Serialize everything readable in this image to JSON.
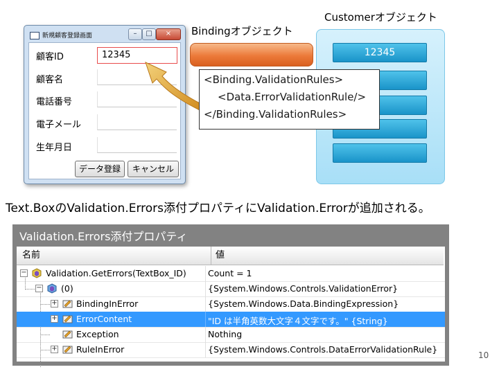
{
  "window": {
    "title": "新規顧客登録画面",
    "min_label": "–",
    "max_label": "□",
    "close_label": "×",
    "fields": [
      {
        "label": "顧客ID",
        "value": "12345"
      },
      {
        "label": "顧客名",
        "value": ""
      },
      {
        "label": "電話番号",
        "value": ""
      },
      {
        "label": "電子メール",
        "value": ""
      },
      {
        "label": "生年月日",
        "value": ""
      }
    ],
    "save_button": "データ登録",
    "cancel_button": "キャンセル"
  },
  "diagram": {
    "binding_label": "Bindingオブジェクト",
    "customer_label": "Customerオブジェクト",
    "customer_first_value": "12345",
    "rules_lines": [
      "<Binding.ValidationRules>",
      "<Data.ErrorValidationRule/>",
      "</Binding.ValidationRules>"
    ]
  },
  "caption": "Text.BoxのValidation.Errors添付プロパティにValidation.Errorが追加される。",
  "properties": {
    "panel_title": "Validation.Errors添付プロパティ",
    "header_name": "名前",
    "header_value": "値",
    "rows": [
      {
        "name": "Validation.GetErrors(TextBox_ID)",
        "value": "Count = 1",
        "expander": "−",
        "selected": false
      },
      {
        "name": "(0)",
        "value": "{System.Windows.Controls.ValidationError}",
        "expander": "−",
        "selected": false
      },
      {
        "name": "BindingInError",
        "value": "{System.Windows.Data.BindingExpression}",
        "expander": "+",
        "selected": false
      },
      {
        "name": "ErrorContent",
        "value": "\"ID は半角英数大文字４文字です。\" {String}",
        "expander": "+",
        "selected": true
      },
      {
        "name": "Exception",
        "value": "Nothing",
        "expander": "",
        "selected": false
      },
      {
        "name": "RuleInError",
        "value": "{System.Windows.Controls.DataErrorValidationRule}",
        "expander": "+",
        "selected": false
      }
    ]
  },
  "page_number": "10",
  "colors": {
    "binding_orange": "#ec7a3a",
    "customer_blue": "#1a94c9",
    "selection_blue": "#3399ff",
    "error_red": "#e84b4b",
    "arrow_gold": "#e2a12a"
  }
}
